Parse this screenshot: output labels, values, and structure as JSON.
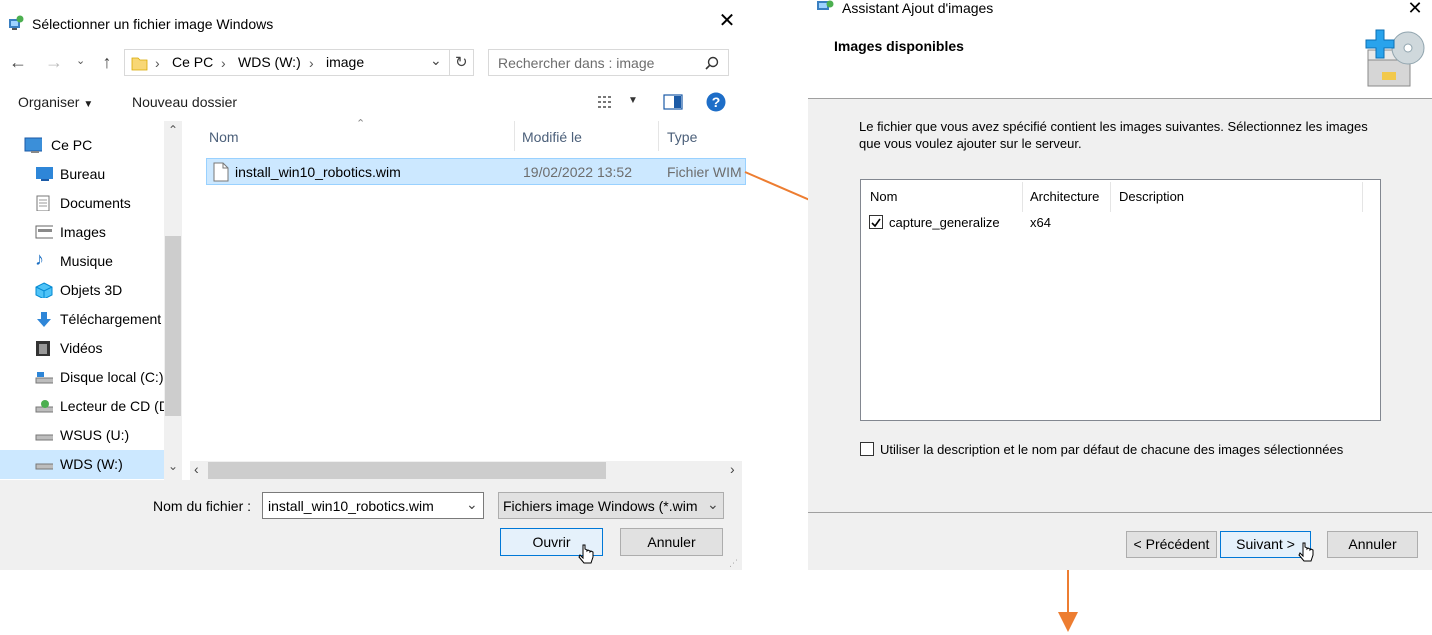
{
  "file_dialog": {
    "title": "Sélectionner un fichier image Windows",
    "breadcrumb": [
      "Ce PC",
      "WDS (W:)",
      "image"
    ],
    "search_placeholder": "Rechercher dans : image",
    "toolbar": {
      "organize": "Organiser",
      "new_folder": "Nouveau dossier"
    },
    "sidebar": [
      {
        "label": "Ce PC",
        "icon": "pc-icon"
      },
      {
        "label": "Bureau",
        "icon": "desktop-icon"
      },
      {
        "label": "Documents",
        "icon": "documents-icon"
      },
      {
        "label": "Images",
        "icon": "pictures-icon"
      },
      {
        "label": "Musique",
        "icon": "music-icon"
      },
      {
        "label": "Objets 3D",
        "icon": "3d-objects-icon"
      },
      {
        "label": "Téléchargement",
        "icon": "downloads-icon"
      },
      {
        "label": "Vidéos",
        "icon": "videos-icon"
      },
      {
        "label": "Disque local (C:)",
        "icon": "drive-icon"
      },
      {
        "label": "Lecteur de CD (D",
        "icon": "cd-drive-icon"
      },
      {
        "label": "WSUS (U:)",
        "icon": "drive-icon"
      },
      {
        "label": "WDS (W:)",
        "icon": "drive-icon"
      }
    ],
    "columns": {
      "name": "Nom",
      "modified": "Modifié le",
      "type": "Type"
    },
    "files": [
      {
        "name": "install_win10_robotics.wim",
        "modified": "19/02/2022 13:52",
        "type": "Fichier WIM"
      }
    ],
    "filename_label": "Nom du fichier :",
    "filename_value": "install_win10_robotics.wim",
    "filter_value": "Fichiers image Windows (*.wim",
    "open_label": "Ouvrir",
    "cancel_label": "Annuler"
  },
  "wizard": {
    "title": "Assistant Ajout d'images",
    "header": "Images disponibles",
    "description": "Le fichier que vous avez spécifié contient les images suivantes. Sélectionnez les images que vous voulez ajouter sur le serveur.",
    "columns": {
      "name": "Nom",
      "arch": "Architecture",
      "desc": "Description"
    },
    "images": [
      {
        "name": "capture_generalize",
        "arch": "x64",
        "desc": "",
        "checked": true
      }
    ],
    "default_checkbox_label": "Utiliser la description et le nom par défaut de chacune des images sélectionnées",
    "default_checked": false,
    "prev_label": "< Précédent",
    "next_label": "Suivant >",
    "cancel_label": "Annuler"
  },
  "colors": {
    "arrow": "#ed7d31",
    "selection": "#cce8ff",
    "accent": "#0078d7"
  }
}
